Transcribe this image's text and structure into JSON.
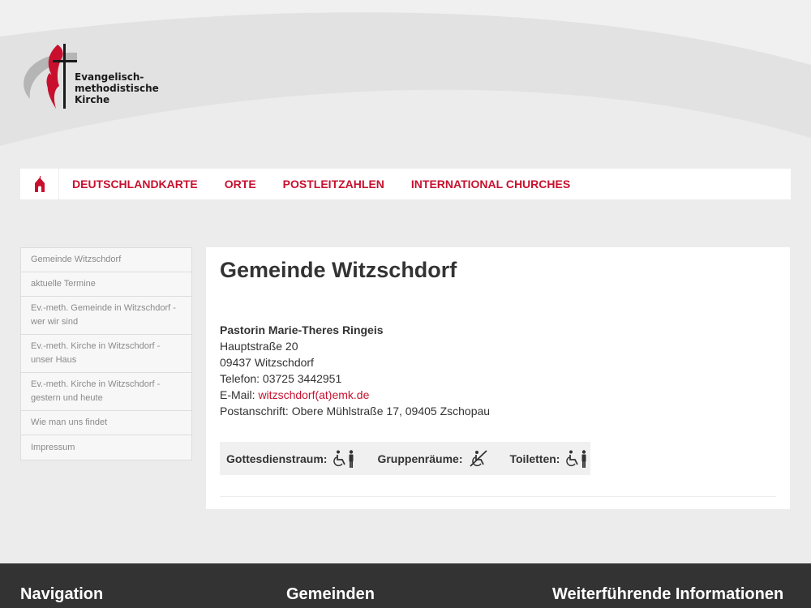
{
  "logo": {
    "line1": "Evangelisch-",
    "line2": "methodistische",
    "line3": "Kirche",
    "icon": "cross-and-flame-logo"
  },
  "nav": {
    "home_icon": "church-icon",
    "items": [
      "DEUTSCHLANDKARTE",
      "ORTE",
      "POSTLEITZAHLEN",
      "INTERNATIONAL CHURCHES"
    ]
  },
  "sidebar": {
    "items": [
      "Gemeinde Witzschdorf",
      "aktuelle Termine",
      "Ev.-meth. Gemeinde in Witzschdorf - wer wir sind",
      "Ev.-meth. Kirche in Witzschdorf - unser Haus",
      "Ev.-meth. Kirche in Witzschdorf - gestern und heute",
      "Wie man uns findet",
      "Impressum"
    ]
  },
  "main": {
    "title": "Gemeinde Witzschdorf",
    "pastor": "Pastorin Marie-Theres Ringeis",
    "street": "Hauptstraße 20",
    "city": "09437 Witzschdorf",
    "phone": "Telefon: 03725 3442951",
    "email_label": "E-Mail: ",
    "email": "witzschdorf(at)emk.de",
    "postal": "Postanschrift: Obere Mühlstraße 17, 09405 Zschopau",
    "accessibility": {
      "worship_label": "Gottesdienstraum:",
      "worship_icon": "wheelchair-accessible-icon",
      "groups_label": "Gruppenräume:",
      "groups_icon": "not-wheelchair-accessible-icon",
      "toilets_label": "Toiletten:",
      "toilets_icon": "wheelchair-accessible-icon"
    }
  },
  "footer": {
    "col1": "Navigation",
    "col2": "Gemeinden",
    "col3": "Weiterführende Informationen"
  },
  "colors": {
    "accent": "#c8102e",
    "footer_bg": "#333333",
    "page_bg": "#ececec"
  }
}
